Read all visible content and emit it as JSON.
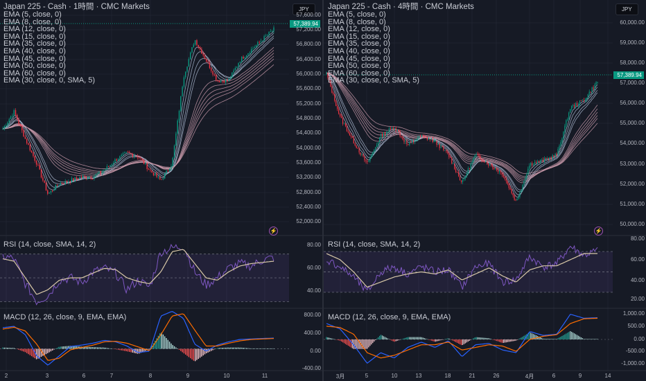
{
  "left": {
    "title": "Japan 225 - Cash · 1時間 · CMC Markets",
    "currency": "JPY",
    "current_price": "57,389.94",
    "indicators": [
      "EMA (5, close, 0)",
      "EMA (8, close, 0)",
      "EMA (12, close, 0)",
      "EMA (15, close, 0)",
      "EMA (35, close, 0)",
      "EMA (40, close, 0)",
      "EMA (45, close, 0)",
      "EMA (50, close, 0)",
      "EMA (60, close, 0)",
      "EMA (30, close, 0, SMA, 5)"
    ],
    "price_ticks": [
      "57,600.00",
      "57,200.00",
      "56,800.00",
      "56,400.00",
      "56,000.00",
      "55,600.00",
      "55,200.00",
      "54,800.00",
      "54,400.00",
      "54,000.00",
      "53,600.00",
      "53,200.00",
      "52,800.00",
      "52,400.00",
      "52,000.00"
    ],
    "rsi_label": "RSI (14, close, SMA, 14, 2)",
    "rsi_ticks": [
      "80.00",
      "60.00",
      "40.00"
    ],
    "macd_label": "MACD (12, 26, close, 9, EMA, EMA)",
    "macd_ticks": [
      "800.00",
      "400.00",
      "0.00",
      "-400.00"
    ],
    "x_ticks": [
      "2",
      "3",
      "6",
      "7",
      "8",
      "9",
      "10",
      "11"
    ]
  },
  "right": {
    "title": "Japan 225 - Cash · 4時間 · CMC Markets",
    "currency": "JPY",
    "current_price": "57,389.94",
    "indicators": [
      "EMA (5, close, 0)",
      "EMA (8, close, 0)",
      "EMA (12, close, 0)",
      "EMA (15, close, 0)",
      "EMA (35, close, 0)",
      "EMA (40, close, 0)",
      "EMA (45, close, 0)",
      "EMA (50, close, 0)",
      "EMA (60, close, 0)",
      "EMA (30, close, 0, SMA, 5)"
    ],
    "price_ticks": [
      "60,000.00",
      "59,000.00",
      "58,000.00",
      "57,000.00",
      "56,000.00",
      "55,000.00",
      "54,000.00",
      "53,000.00",
      "52,000.00",
      "51,000.00",
      "50,000.00"
    ],
    "rsi_label": "RSI (14, close, SMA, 14, 2)",
    "rsi_ticks": [
      "80.00",
      "60.00",
      "40.00",
      "20.00"
    ],
    "macd_label": "MACD (12, 26, close, 9, EMA, EMA)",
    "macd_ticks": [
      "1,000.00",
      "500.00",
      "0.00",
      "-500.00",
      "-1,000.00"
    ],
    "x_ticks": [
      "3月",
      "5",
      "10",
      "13",
      "18",
      "21",
      "26",
      "4月",
      "6",
      "9",
      "14"
    ]
  },
  "colors": {
    "up": "#089981",
    "down": "#f23645",
    "ema_short": "#aab8d0",
    "ema_long": "#c99aaa",
    "rsi": "#7e57c2",
    "rsi_ma": "#d9c9a8",
    "macd": "#2962ff",
    "signal": "#ff6d00",
    "bg": "#161a25"
  },
  "chart_data": [
    {
      "type": "candlestick",
      "title": "Japan 225 - Cash · 1時間",
      "ylim": [
        51800,
        57800
      ],
      "close_path": [
        54500,
        55000,
        54200,
        53500,
        52600,
        52900,
        53000,
        53100,
        53100,
        53300,
        53600,
        53800,
        53700,
        53300,
        53000,
        53500,
        56000,
        57100,
        56500,
        55900,
        55900,
        56500,
        56800,
        57100,
        57390
      ],
      "rsi_path": [
        68,
        66,
        45,
        30,
        35,
        48,
        50,
        46,
        55,
        58,
        54,
        40,
        48,
        42,
        72,
        75,
        77,
        55,
        44,
        50,
        58,
        62,
        60,
        65,
        67
      ],
      "rsi_ma_path": [
        66,
        64,
        50,
        36,
        40,
        48,
        50,
        50,
        54,
        58,
        57,
        50,
        47,
        45,
        55,
        72,
        74,
        62,
        50,
        48,
        55,
        60,
        62,
        63,
        64
      ],
      "macd_path": [
        450,
        480,
        300,
        -150,
        -350,
        -150,
        50,
        80,
        120,
        180,
        150,
        60,
        -80,
        -50,
        700,
        800,
        650,
        100,
        -50,
        80,
        150,
        200,
        210,
        220,
        230
      ],
      "signal_path": [
        420,
        460,
        380,
        100,
        -250,
        -200,
        -20,
        30,
        80,
        150,
        160,
        120,
        40,
        -40,
        300,
        700,
        750,
        400,
        60,
        60,
        120,
        170,
        200,
        210,
        220
      ],
      "rsi_ylim": [
        25,
        85
      ],
      "macd_ylim": [
        -450,
        850
      ]
    },
    {
      "type": "candlestick",
      "title": "Japan 225 - Cash · 4時間",
      "ylim": [
        49800,
        60500
      ],
      "close_path": [
        57800,
        55500,
        54200,
        53000,
        54500,
        55000,
        54000,
        54500,
        54200,
        53500,
        52000,
        53500,
        53000,
        52500,
        51000,
        53000,
        53200,
        53500,
        56000,
        56400,
        57390
      ],
      "rsi_path": [
        62,
        55,
        45,
        30,
        50,
        55,
        48,
        55,
        50,
        52,
        35,
        55,
        58,
        40,
        42,
        65,
        55,
        58,
        75,
        66,
        71
      ],
      "rsi_ma_path": [
        68,
        62,
        50,
        35,
        40,
        45,
        48,
        50,
        48,
        52,
        42,
        48,
        54,
        46,
        40,
        52,
        56,
        56,
        62,
        68,
        68
      ],
      "macd_path": [
        600,
        400,
        -200,
        -900,
        -500,
        -700,
        -300,
        -100,
        -300,
        -50,
        -650,
        -200,
        -150,
        -400,
        -500,
        300,
        150,
        200,
        950,
        800,
        820
      ],
      "signal_path": [
        500,
        450,
        200,
        -500,
        -700,
        -600,
        -400,
        -200,
        -200,
        -100,
        -400,
        -300,
        -200,
        -250,
        -450,
        0,
        120,
        180,
        600,
        780,
        800
      ],
      "rsi_ylim": [
        15,
        85
      ],
      "macd_ylim": [
        -1150,
        1150
      ]
    }
  ]
}
